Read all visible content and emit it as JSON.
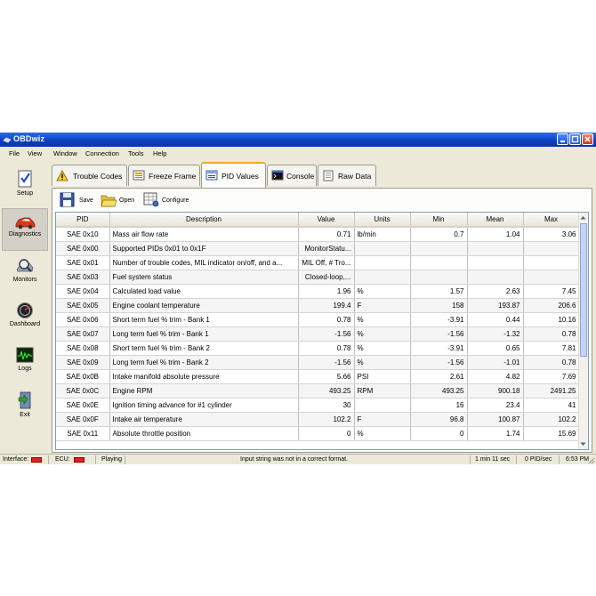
{
  "window": {
    "title": "OBDwiz"
  },
  "menu": [
    "File",
    "View",
    "Window",
    "Connection",
    "Tools",
    "Help"
  ],
  "sidebar": [
    {
      "label": "Setup",
      "icon": "checklist-icon"
    },
    {
      "label": "Diagnostics",
      "icon": "car-icon",
      "active": true
    },
    {
      "label": "Monitors",
      "icon": "magnifier-icon"
    },
    {
      "label": "Dashboard",
      "icon": "gauge-icon"
    },
    {
      "label": "Logs",
      "icon": "waveform-icon"
    },
    {
      "label": "Exit",
      "icon": "exit-door-icon"
    }
  ],
  "tabs": [
    {
      "label": "Trouble Codes",
      "icon": "warning-icon"
    },
    {
      "label": "Freeze Frame",
      "icon": "freeze-frame-icon"
    },
    {
      "label": "PID Values",
      "icon": "pid-values-icon",
      "active": true
    },
    {
      "label": "Console",
      "icon": "console-icon"
    },
    {
      "label": "Raw Data",
      "icon": "raw-data-icon"
    }
  ],
  "toolbar": {
    "save": "Save",
    "open": "Open",
    "configure": "Configure"
  },
  "table": {
    "headers": [
      "PID",
      "Description",
      "Value",
      "Units",
      "Min",
      "Mean",
      "Max"
    ],
    "rows": [
      [
        "SAE 0x10",
        "Mass air flow rate",
        "0.71",
        "lb/min",
        "0.7",
        "1.04",
        "3.06"
      ],
      [
        "SAE 0x00",
        "Supported PIDs 0x01 to 0x1F",
        "MonitorStatu...",
        "",
        "",
        "",
        ""
      ],
      [
        "SAE 0x01",
        "Number of trouble codes, MIL indicator on/off, and a...",
        "MIL Off, # Tro...",
        "",
        "",
        "",
        ""
      ],
      [
        "SAE 0x03",
        "Fuel system status",
        "Closed-loop,...",
        "",
        "",
        "",
        ""
      ],
      [
        "SAE 0x04",
        "Calculated load value",
        "1.96",
        "%",
        "1.57",
        "2.63",
        "7.45"
      ],
      [
        "SAE 0x05",
        "Engine coolant temperature",
        "199.4",
        "F",
        "158",
        "193.87",
        "206.6"
      ],
      [
        "SAE 0x06",
        "Short term fuel % trim - Bank 1",
        "0.78",
        "%",
        "-3.91",
        "0.44",
        "10.16"
      ],
      [
        "SAE 0x07",
        "Long term fuel % trim - Bank 1",
        "-1.56",
        "%",
        "-1.56",
        "-1.32",
        "0.78"
      ],
      [
        "SAE 0x08",
        "Short term fuel % trim - Bank 2",
        "0.78",
        "%",
        "-3.91",
        "0.65",
        "7.81"
      ],
      [
        "SAE 0x09",
        "Long term fuel % trim - Bank 2",
        "-1.56",
        "%",
        "-1.56",
        "-1.01",
        "0.78"
      ],
      [
        "SAE 0x0B",
        "Intake manifold absolute pressure",
        "5.66",
        "PSI",
        "2.61",
        "4.82",
        "7.69"
      ],
      [
        "SAE 0x0C",
        "Engine RPM",
        "493.25",
        "RPM",
        "493.25",
        "900.18",
        "2491.25"
      ],
      [
        "SAE 0x0E",
        "Ignition timing advance for #1 cylinder",
        "30",
        "",
        "16",
        "23.4",
        "41"
      ],
      [
        "SAE 0x0F",
        "Intake air temperature",
        "102.2",
        "F",
        "96.8",
        "100.87",
        "102.2"
      ],
      [
        "SAE 0x11",
        "Absolute throttle position",
        "0",
        "%",
        "0",
        "1.74",
        "15.69"
      ]
    ]
  },
  "status": {
    "interface_label": "Interface:",
    "ecu_label": "ECU:",
    "state": "Playing",
    "message": "Input string was not in a correct format.",
    "elapsed": "1 min 11 sec",
    "rate": "0 PID/sec",
    "time": "6:53 PM",
    "led_color": "#dd2222"
  }
}
